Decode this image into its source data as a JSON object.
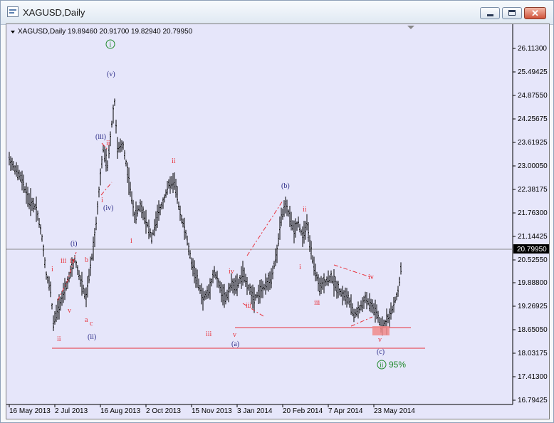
{
  "window": {
    "title": "XAGUSD,Daily"
  },
  "chart": {
    "symbol_info": "XAGUSD,Daily  19.89460 20.91700 19.82940 20.79950",
    "current_price": "20.79950",
    "price_ticks": [
      "26.11300",
      "25.49425",
      "24.87550",
      "24.25675",
      "23.61925",
      "23.00050",
      "22.38175",
      "21.76300",
      "21.14425",
      "20.52550",
      "19.88800",
      "19.26925",
      "18.65050",
      "18.03175",
      "17.41300",
      "16.79425"
    ],
    "date_ticks": [
      "16 May 2013",
      "2 Jul 2013",
      "16 Aug 2013",
      "2 Oct 2013",
      "15 Nov 2013",
      "3 Jan 2014",
      "20 Feb 2014",
      "7 Apr 2014",
      "23 May 2014"
    ],
    "annotation": "95%",
    "colors": {
      "bg": "#e6e6fa",
      "bars": "#000000",
      "red": "#e8313b",
      "blue": "#2b2b88",
      "green": "#1f8a2a",
      "zone": "#f08a8a"
    },
    "wave_labels": [
      {
        "t": "(i)",
        "c": "blue"
      },
      {
        "t": "(ii)",
        "c": "blue"
      },
      {
        "t": "(iii)",
        "c": "blue"
      },
      {
        "t": "(iv)",
        "c": "blue"
      },
      {
        "t": "(v)",
        "c": "blue"
      },
      {
        "t": "(a)",
        "c": "blue"
      },
      {
        "t": "(b)",
        "c": "blue"
      },
      {
        "t": "(c)",
        "c": "blue"
      },
      {
        "t": "i",
        "c": "red"
      },
      {
        "t": "ii",
        "c": "red"
      },
      {
        "t": "iii",
        "c": "red"
      },
      {
        "t": "iv",
        "c": "red"
      },
      {
        "t": "v",
        "c": "red"
      },
      {
        "t": "a",
        "c": "red"
      },
      {
        "t": "b",
        "c": "red"
      },
      {
        "t": "c",
        "c": "red"
      },
      {
        "t": "i",
        "c": "red"
      },
      {
        "t": "ii",
        "c": "red"
      },
      {
        "t": "iii",
        "c": "red"
      },
      {
        "t": "iv",
        "c": "red"
      },
      {
        "t": "v",
        "c": "red"
      },
      {
        "t": "i",
        "c": "red"
      },
      {
        "t": "ii",
        "c": "red"
      },
      {
        "t": "iii",
        "c": "red"
      },
      {
        "t": "iv",
        "c": "red"
      },
      {
        "t": "v",
        "c": "red"
      },
      {
        "t": "i",
        "c": "red"
      },
      {
        "t": "ii",
        "c": "red"
      },
      {
        "t": "iii",
        "c": "red"
      }
    ],
    "circle_labels": [
      "i",
      "ii"
    ]
  }
}
